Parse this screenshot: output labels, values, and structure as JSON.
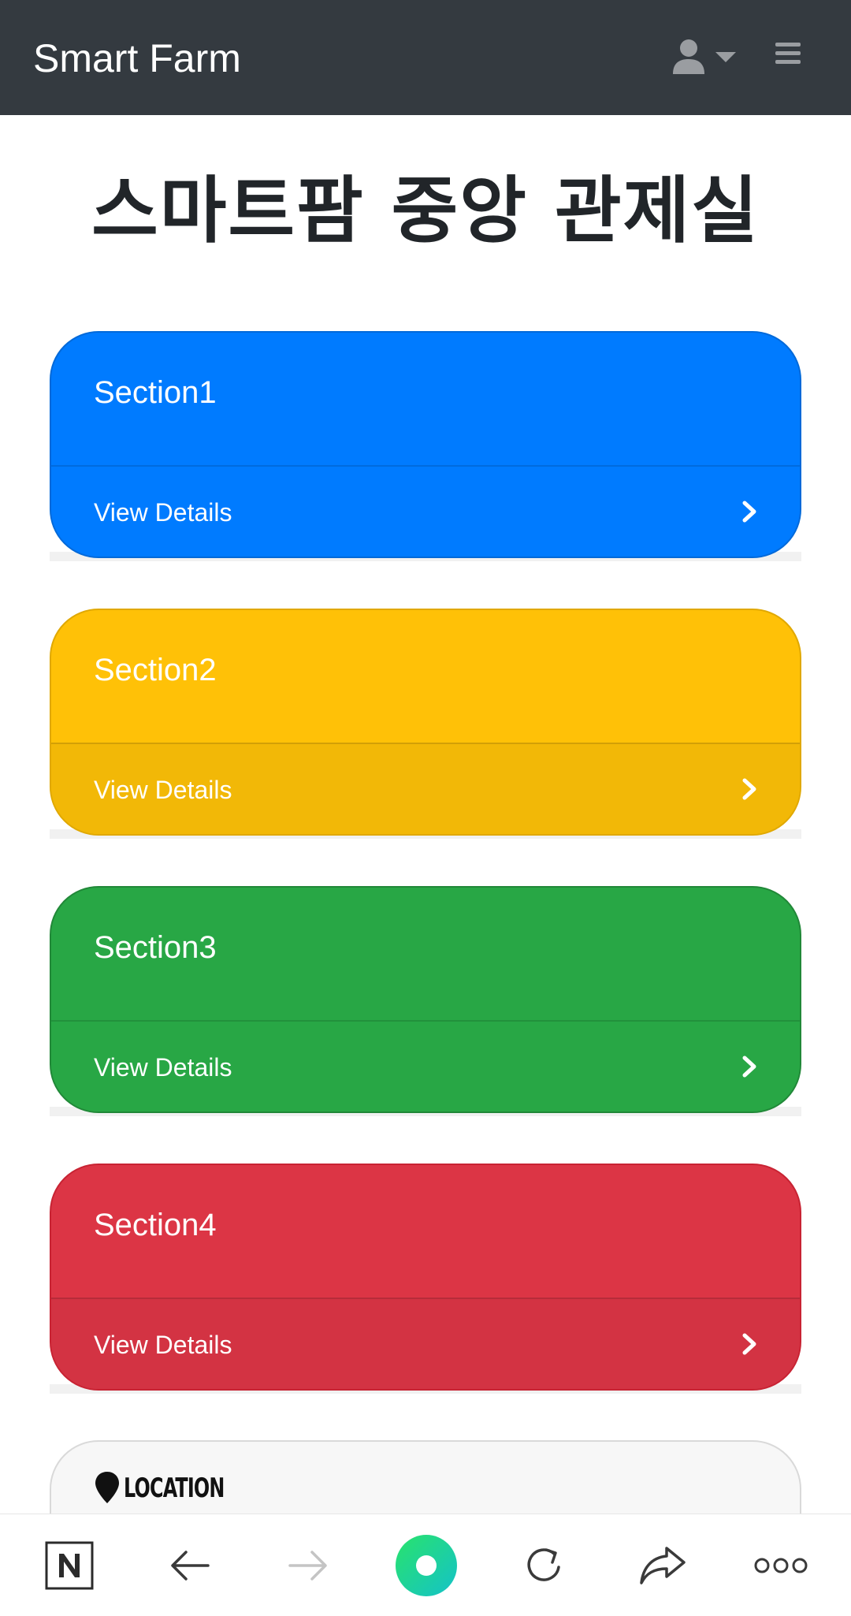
{
  "navbar": {
    "brand": "Smart Farm",
    "user_icon": "user-icon",
    "caret_icon": "caret-down-icon",
    "menu_icon": "hamburger-menu-icon"
  },
  "page_title": "스마트팜 중앙 관제실",
  "sections": [
    {
      "title": "Section1",
      "footer_label": "View Details",
      "color": "#007bff",
      "footer_color": "#007bff",
      "border": "#0069d9"
    },
    {
      "title": "Section2",
      "footer_label": "View Details",
      "color": "#ffc107",
      "footer_color": "#f2b807",
      "border": "#e0a800"
    },
    {
      "title": "Section3",
      "footer_label": "View Details",
      "color": "#28a745",
      "footer_color": "#28a745",
      "border": "#218838"
    },
    {
      "title": "Section4",
      "footer_label": "View Details",
      "color": "#dc3545",
      "footer_color": "#d33343",
      "border": "#c82333"
    }
  ],
  "location": {
    "label": "LOCATION",
    "icon": "map-marker-icon"
  },
  "browser_bar": {
    "items": [
      "naver-home-icon",
      "back-arrow-icon",
      "forward-arrow-icon",
      "green-dot-assistant-icon",
      "reload-icon",
      "share-icon",
      "more-icon"
    ]
  }
}
